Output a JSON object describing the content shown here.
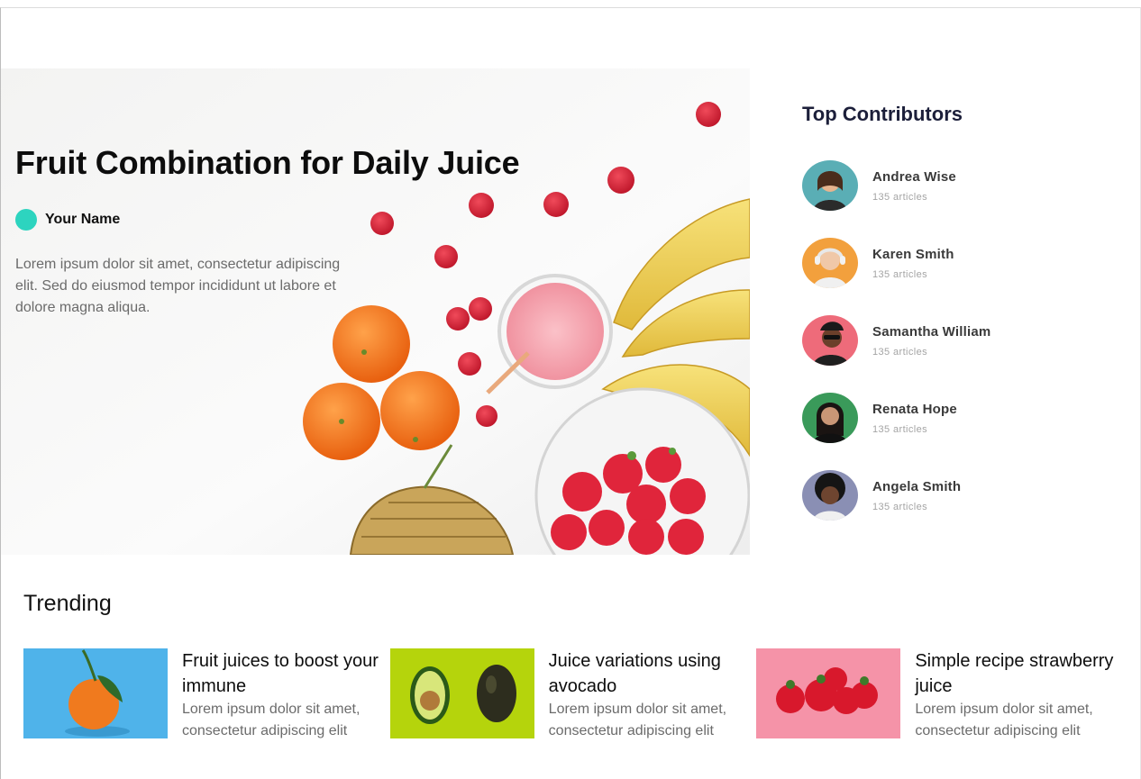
{
  "hero": {
    "title": "Fruit Combination for Daily Juice",
    "author_name": "Your Name",
    "description": "Lorem ipsum dolor sit amet, consectetur adipiscing elit. Sed do eiusmod tempor incididunt ut labore et dolore magna aliqua.",
    "author_color": "#2dd4bf"
  },
  "sidebar": {
    "title": "Top Contributors",
    "contributors": [
      {
        "name": "Andrea Wise",
        "articles": "135 articles",
        "avatar_color": "#5aaeb5"
      },
      {
        "name": "Karen Smith",
        "articles": "135 articles",
        "avatar_color": "#f2a03d"
      },
      {
        "name": "Samantha William",
        "articles": "135 articles",
        "avatar_color": "#ee6b7a"
      },
      {
        "name": "Renata Hope",
        "articles": "135 articles",
        "avatar_color": "#3a9a5a"
      },
      {
        "name": "Angela Smith",
        "articles": "135 articles",
        "avatar_color": "#8a8fb4"
      }
    ]
  },
  "trending": {
    "title": "Trending",
    "items": [
      {
        "title": "Fruit juices to boost your immune",
        "description": "Lorem ipsum dolor sit amet, consectetur adipiscing elit",
        "thumb_color": "#4fb3ea"
      },
      {
        "title": "Juice variations using avocado",
        "description": "Lorem ipsum dolor sit amet, consectetur adipiscing elit",
        "thumb_color": "#b5d40c"
      },
      {
        "title": "Simple recipe strawberry juice",
        "description": "Lorem ipsum dolor sit amet, consectetur adipiscing elit",
        "thumb_color": "#f593a8"
      }
    ]
  }
}
